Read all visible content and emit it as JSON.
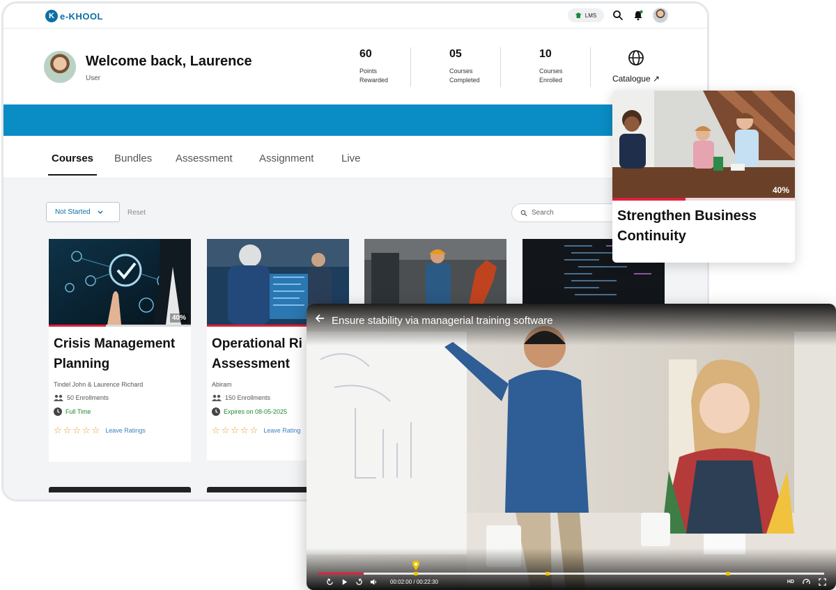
{
  "app": {
    "brand": "e-KHOOL",
    "lms_label": "LMS"
  },
  "welcome": {
    "title": "Welcome back, Laurence",
    "role": "User"
  },
  "stats": [
    {
      "value": "60",
      "label": "Points\nRewarded"
    },
    {
      "value": "05",
      "label": "Courses\nCompleted"
    },
    {
      "value": "10",
      "label": "Courses\nEnrolled"
    }
  ],
  "catalogue_label": "Catalogue ↗",
  "tabs": [
    "Courses",
    "Bundles",
    "Assessment",
    "Assignment",
    "Live"
  ],
  "filters": {
    "status": "Not Started",
    "reset": "Reset",
    "search_placeholder": "Search"
  },
  "courses": [
    {
      "title": "Crisis Management Planning",
      "author": "Tindel John & Laurence Richard",
      "enrollments": "50 Enrollments",
      "badge": "Full Time",
      "progress": 40,
      "progress_label": "40%",
      "ratings_label": "Leave Ratings"
    },
    {
      "title": "Operational Ri Assessment",
      "author": "Abiram",
      "enrollments": "150 Enrollments",
      "badge": "Expires on 08-05-2025",
      "ratings_label": "Leave Rating"
    }
  ],
  "featured_course": {
    "title": "Strengthen Business Continuity",
    "progress": 40,
    "progress_label": "40%"
  },
  "video": {
    "title": "Ensure stability via managerial training software",
    "time": "00:02:00 / 00:22:30",
    "progress": 0.09,
    "quality": "HD"
  },
  "colors": {
    "brand": "#0b6fa4",
    "banner": "#0a8cc4",
    "progress": "#e0203c",
    "star": "#e09a1a",
    "success": "#1f8a2e",
    "marker": "#f2c400"
  }
}
